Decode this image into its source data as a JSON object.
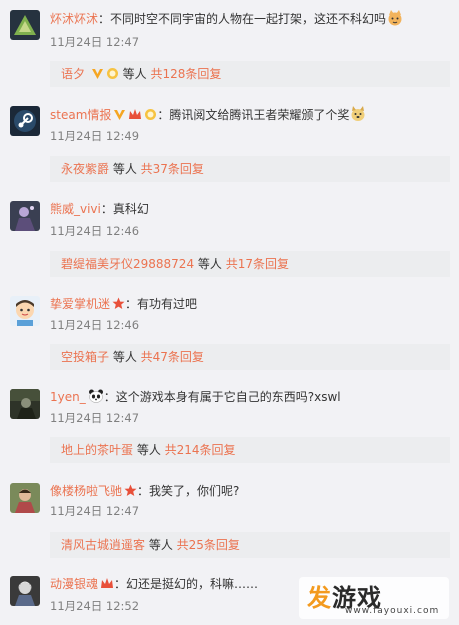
{
  "comments": [
    {
      "username": "炋沭炋沭",
      "separator": "：",
      "text": "不同时空不同宇宙的人物在一起打架，这还不科幻吗",
      "emoji": "cat-face",
      "time": "11月24日 12:47",
      "reply": {
        "name": "语夕",
        "mid": " 等人 ",
        "count": "共128条回复"
      }
    },
    {
      "username": "steam情报",
      "separator": "：",
      "text": "腾讯阅文给腾讯王者荣耀颁了个奖",
      "emoji": "doge",
      "time": "11月24日 12:49",
      "reply": {
        "name": "永夜紫爵",
        "mid": " 等人 ",
        "count": "共37条回复"
      }
    },
    {
      "username": "熊威_vivi",
      "separator": "：",
      "text": "真科幻",
      "time": "11月24日 12:46",
      "reply": {
        "name": "碧缇福美牙仪29888724",
        "mid": " 等人 ",
        "count": "共17条回复"
      }
    },
    {
      "username": "挚爱掌机迷",
      "separator": "：",
      "text": "有功有过吧",
      "time": "11月24日 12:46",
      "reply": {
        "name": "空投箱子",
        "mid": " 等人 ",
        "count": "共47条回复"
      }
    },
    {
      "username": "1yen_",
      "separator": "：",
      "text": "这个游戏本身有属于它自己的东西吗?xswl",
      "time": "11月24日 12:47",
      "reply": {
        "name": "地上的茶叶蛋",
        "mid": " 等人 ",
        "count": "共214条回复"
      }
    },
    {
      "username": "像楼杨啦飞驰",
      "separator": "：",
      "text": "我笑了，你们呢?",
      "time": "11月24日 12:47",
      "reply": {
        "name": "清风古城逍遥客",
        "mid": " 等人 ",
        "count": "共25条回复"
      }
    },
    {
      "username": "动漫银魂",
      "separator": "：",
      "text": "幻还是挺幻的，科嘛……",
      "time": "11月24日 12:52"
    }
  ],
  "watermark": {
    "main_first": "发",
    "main_rest": "游戏",
    "sub": "www.fayouxi.com"
  },
  "colors": {
    "username": "#eb7350",
    "background": "#f2f2f5",
    "reply_bg": "#ecedef",
    "time": "#808080"
  }
}
